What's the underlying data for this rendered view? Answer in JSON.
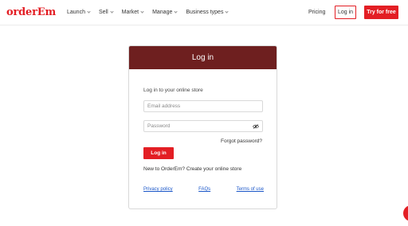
{
  "header": {
    "logo": "orderEm",
    "nav": [
      "Launch",
      "Sell",
      "Market",
      "Manage",
      "Business types"
    ],
    "pricing": "Pricing",
    "login": "Log in",
    "try": "Try for free"
  },
  "card": {
    "title": "Log in",
    "subtitle": "Log in to your online store",
    "email_placeholder": "Email address",
    "password_placeholder": "Password",
    "forgot": "Forgot password?",
    "login_button": "Log in",
    "new_to": "New to OrderEm? Create your online store",
    "links": [
      "Privacy policy",
      "FAQs",
      "Terms of use"
    ]
  },
  "icons": {
    "password_toggle": "eye-slash-icon",
    "chat": "chat-bubble-icon"
  },
  "colors": {
    "brand": "#e31e24",
    "card_header": "#6e1f1f",
    "link": "#1a56c8"
  }
}
